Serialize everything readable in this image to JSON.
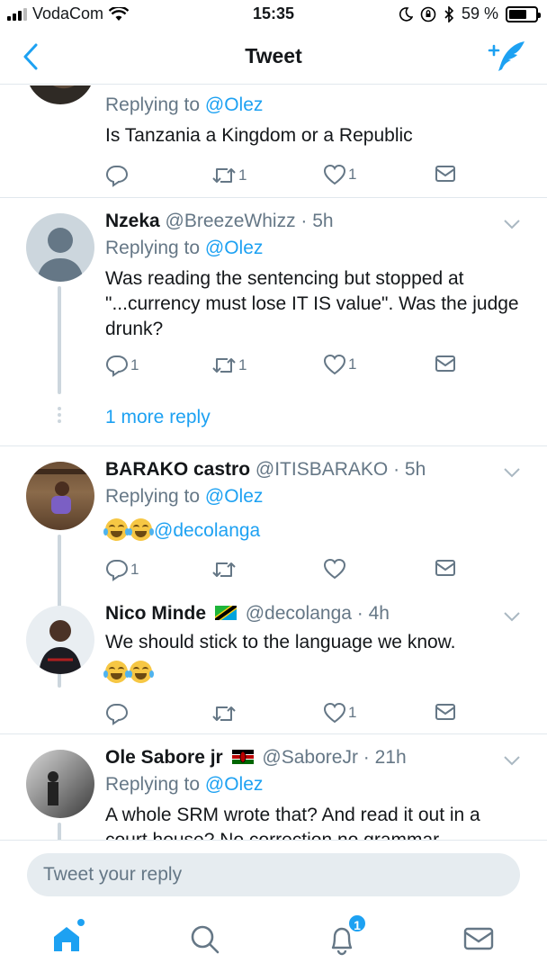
{
  "status_bar": {
    "carrier": "VodaCom",
    "time": "15:35",
    "battery": "59 %"
  },
  "nav": {
    "title": "Tweet"
  },
  "tweets": [
    {
      "replying_label": "Replying to",
      "replying_to": "@Olez",
      "text": "Is Tanzania a Kingdom or a Republic",
      "retweets": "1",
      "likes": "1"
    },
    {
      "name": "Nzeka",
      "handle": "@BreezeWhizz",
      "time": "5h",
      "replying_label": "Replying to",
      "replying_to": "@Olez",
      "text": "Was reading the sentencing but stopped at \"...currency must lose IT IS value\". Was the judge drunk?",
      "replies": "1",
      "retweets": "1",
      "likes": "1",
      "more_replies": "1 more reply"
    },
    {
      "name": "BARAKO castro",
      "handle": "@ITISBARAKO",
      "time": "5h",
      "replying_label": "Replying to",
      "replying_to": "@Olez",
      "text_mention": "@decolanga",
      "replies": "1"
    },
    {
      "name": "Nico Minde",
      "handle": "@decolanga",
      "time": "4h",
      "text": "We should stick to the language we know.",
      "likes": "1"
    },
    {
      "name": "Ole Sabore jr",
      "handle": "@SaboreJr",
      "time": "21h",
      "replying_label": "Replying to",
      "replying_to": "@Olez",
      "text": "A whole SRM wrote that? And read it out in a court house? No correction no grammar"
    }
  ],
  "composer": {
    "placeholder": "Tweet your reply"
  },
  "tabbar": {
    "notifications_badge": "1"
  },
  "colors": {
    "accent": "#1da1f2",
    "secondary_text": "#657786",
    "divider": "#e1e8ed"
  },
  "icons": [
    "back-chevron-icon",
    "compose-tweet-icon",
    "reply-icon",
    "retweet-icon",
    "like-icon",
    "dm-icon",
    "home-icon",
    "search-icon",
    "notifications-icon",
    "messages-icon"
  ]
}
